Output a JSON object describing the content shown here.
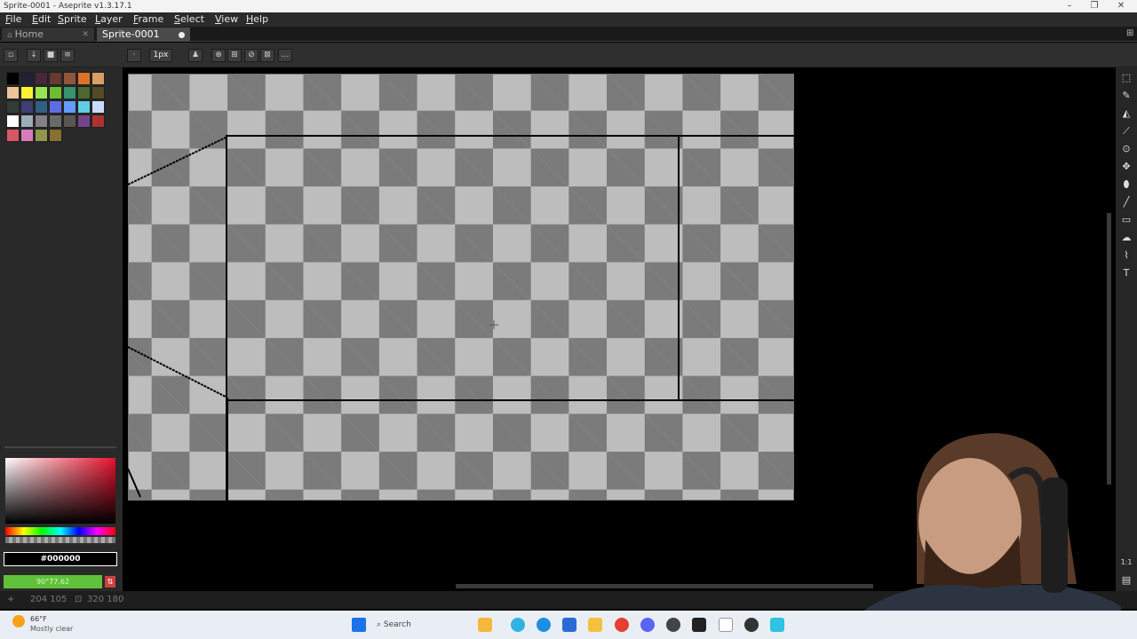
{
  "window": {
    "title": "Sprite-0001 - Aseprite v1.3.17.1"
  },
  "menu": [
    "File",
    "Edit",
    "Sprite",
    "Layer",
    "Frame",
    "Select",
    "View",
    "Help"
  ],
  "tabs": {
    "home": "Home",
    "sprite": "Sprite-0001"
  },
  "toolbar": {
    "brush_size": "1px"
  },
  "color": {
    "foreground_hex": "#000000",
    "background_label": "90°77.62"
  },
  "status": {
    "coords": "204 105",
    "size": "320 180"
  },
  "taskbar": {
    "weather_temp": "66°F",
    "weather_desc": "Mostly clear",
    "search": "Search"
  },
  "palette_colors": [
    "#000000",
    "#222034",
    "#45283c",
    "#663931",
    "#8f563b",
    "#df7126",
    "#d9a066",
    "#eec39a",
    "#fbf236",
    "#99e550",
    "#6abe30",
    "#37946e",
    "#4b692f",
    "#524b24",
    "#323c39",
    "#3f3f74",
    "#306082",
    "#5b6ee1",
    "#639bff",
    "#5fcde4",
    "#cbdbfc",
    "#ffffff",
    "#9badb7",
    "#847e87",
    "#696a6a",
    "#595652",
    "#76428a",
    "#ac3232",
    "#d95763",
    "#d77bba",
    "#8f974a",
    "#8a6f30"
  ],
  "accent_colors": {
    "bg_field": "#5fc23a",
    "taskbar": "#e9eef4"
  }
}
